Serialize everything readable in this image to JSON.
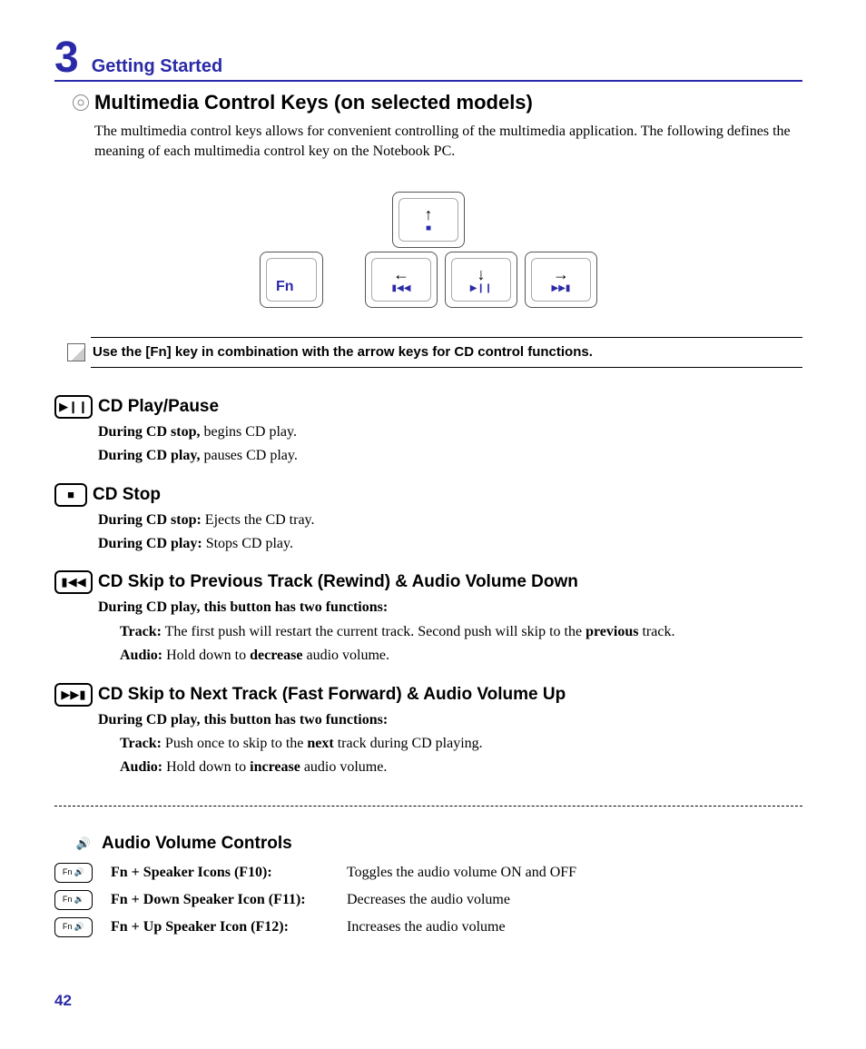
{
  "chapter": {
    "number": "3",
    "title": "Getting Started"
  },
  "section": {
    "heading": "Multimedia Control Keys (on selected models)",
    "intro": "The multimedia control keys allows for convenient controlling of the multimedia application. The following defines the meaning of each multimedia control key on the Notebook PC."
  },
  "keys": {
    "fn": "Fn",
    "up_arrow": "↑",
    "up_media": "■",
    "left_arrow": "←",
    "left_media": "▮◀◀",
    "down_arrow": "↓",
    "down_media": "▶❙❙",
    "right_arrow": "→",
    "right_media": "▶▶▮"
  },
  "note": "Use the [Fn] key in combination with the arrow keys for CD control functions.",
  "items": {
    "play": {
      "title": "CD Play/Pause",
      "l1a": "During CD stop,",
      "l1b": " begins CD play.",
      "l2a": "During CD play,",
      "l2b": " pauses CD play."
    },
    "stop": {
      "title": "CD Stop",
      "l1a": "During CD stop:",
      "l1b": " Ejects the CD tray.",
      "l2a": "During CD play:",
      "l2b": " Stops CD play."
    },
    "prev": {
      "title": "CD Skip to Previous Track (Rewind) & Audio Volume Down",
      "lead": "During CD play, this button has two functions:",
      "t1a": "Track:",
      "t1b": " The first push will restart the current track. Second push will skip to the ",
      "t1c": "previous",
      "t1d": " track.",
      "a1a": "Audio:",
      "a1b": " Hold down to ",
      "a1c": "decrease",
      "a1d": " audio volume."
    },
    "next": {
      "title": "CD Skip to Next Track (Fast Forward) & Audio Volume Up",
      "lead": "During CD play, this button has two functions:",
      "t1a": "Track:",
      "t1b": " Push once to skip to the ",
      "t1c": "next",
      "t1d": " track during CD playing.",
      "a1a": "Audio:",
      "a1b": " Hold down to ",
      "a1c": "increase",
      "a1d": " audio volume."
    }
  },
  "audio": {
    "heading": "Audio Volume Controls",
    "rows": [
      {
        "key": "Fn 🔊",
        "label": "Fn + Speaker Icons (F10):",
        "desc": "Toggles the audio volume ON and OFF"
      },
      {
        "key": "Fn 🔉",
        "label": "Fn + Down Speaker Icon (F11):",
        "desc": "Decreases the audio volume"
      },
      {
        "key": "Fn 🔊",
        "label": "Fn + Up Speaker Icon (F12):",
        "desc": "Increases the audio volume"
      }
    ]
  },
  "page": "42"
}
